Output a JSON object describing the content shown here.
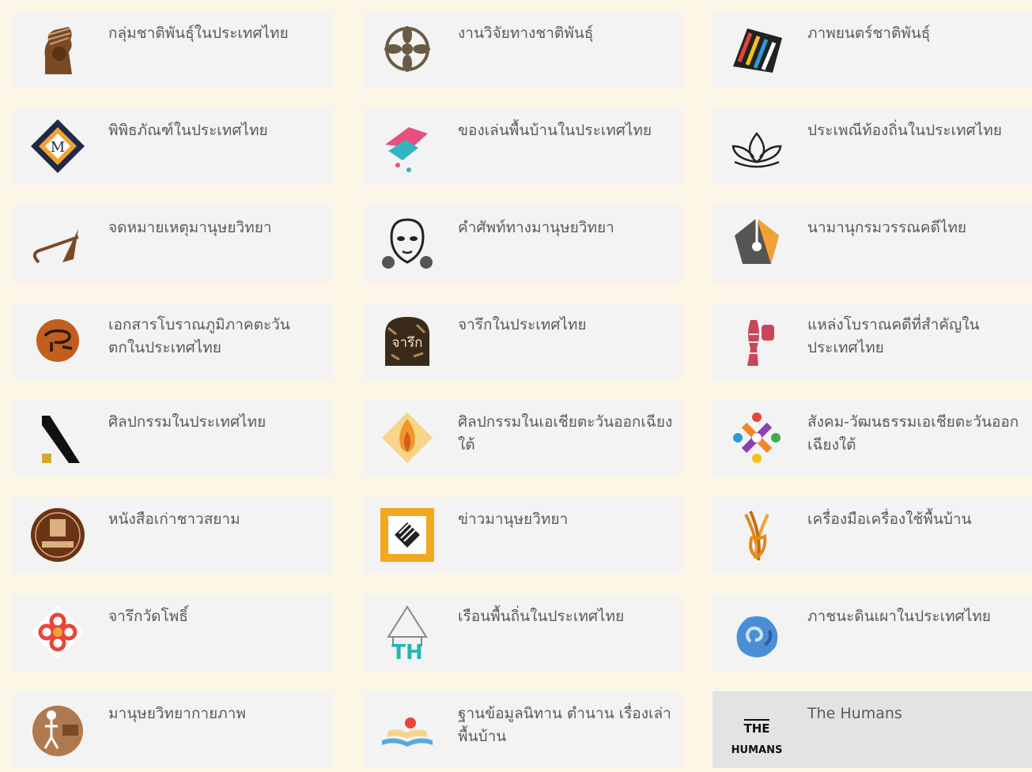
{
  "cards": [
    {
      "label": "กลุ่มชาติพันธุ์ในประเทศไทย",
      "icon": "ethnic-woman-icon"
    },
    {
      "label": "งานวิจัยทางชาติพันธุ์",
      "icon": "wheel-icon"
    },
    {
      "label": "ภาพยนตร์ชาติพันธุ์",
      "icon": "film-strip-icon"
    },
    {
      "label": "พิพิธภัณฑ์ในประเทศไทย",
      "icon": "museum-diamond-icon"
    },
    {
      "label": "ของเล่นพื้นบ้านในประเทศไทย",
      "icon": "fish-mobile-icon"
    },
    {
      "label": "ประเพณีท้องถิ่นในประเทศไทย",
      "icon": "lotus-icon"
    },
    {
      "label": "จดหมายเหตุมานุษยวิทยา",
      "icon": "feather-pen-icon"
    },
    {
      "label": "คำศัพท์ทางมานุษยวิทยา",
      "icon": "mask-icon"
    },
    {
      "label": "นามานุกรมวรรณคดีไทย",
      "icon": "pen-nib-icon"
    },
    {
      "label": "เอกสารโบราณภูมิภาคตะวันตกในประเทศไทย",
      "icon": "ancient-script-icon"
    },
    {
      "label": "จารึกในประเทศไทย",
      "icon": "inscription-stone-icon",
      "logo_text": "จารึก"
    },
    {
      "label": "แหล่งโบราณคดีที่สำคัญในประเทศไทย",
      "icon": "archaeology-icon"
    },
    {
      "label": "ศิลปกรรมในประเทศไทย",
      "icon": "art-slash-icon"
    },
    {
      "label": "ศิลปกรรมในเอเชียตะวันออกเฉียงใต้",
      "icon": "flame-lotus-icon"
    },
    {
      "label": "สังคม-วัฒนธรรมเอเชียตะวันออกเฉียงใต้",
      "icon": "colorful-people-icon"
    },
    {
      "label": "หนังสือเก่าชาวสยาม",
      "icon": "old-book-seal-icon"
    },
    {
      "label": "ข่าวมานุษยวิทยา",
      "icon": "news-paper-icon"
    },
    {
      "label": "เครื่องมือเครื่องใช้พื้นบ้าน",
      "icon": "woven-basket-icon"
    },
    {
      "label": "จารึกวัดโพธิ์",
      "icon": "knot-flower-icon"
    },
    {
      "label": "เรือนพื้นถิ่นในประเทศไทย",
      "icon": "thai-house-icon",
      "logo_text": "TH"
    },
    {
      "label": "ภาชนะดินเผาในประเทศไทย",
      "icon": "pottery-swirl-icon"
    },
    {
      "label": "มานุษยวิทยากายภาพ",
      "icon": "skeleton-icon"
    },
    {
      "label": "ฐานข้อมูลนิทาน ตำนาน เรื่องเล่าพื้นบ้าน",
      "icon": "open-book-icon"
    },
    {
      "label": "The Humans",
      "icon": "the-humans-logo-icon",
      "logo_text_top": "THE",
      "logo_text_bottom": "HUMANS"
    }
  ],
  "colors": {
    "page_background": "#fbf6e6",
    "card_background": "#f3f3f3",
    "card_highlight": "#e3e3e3",
    "label_text": "#5a5a5a"
  }
}
